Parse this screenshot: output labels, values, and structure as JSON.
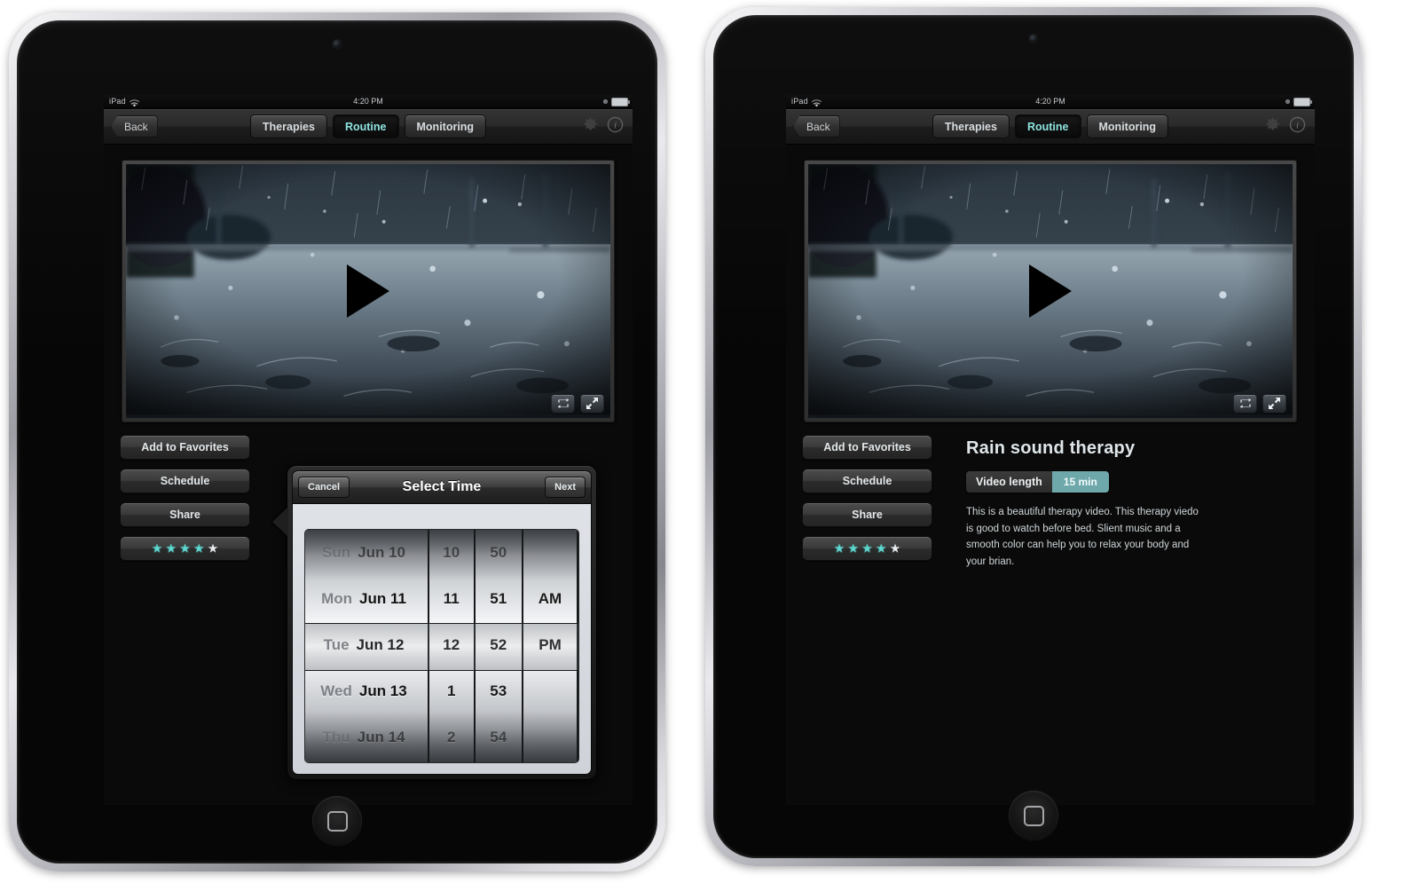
{
  "statusbar": {
    "device": "iPad",
    "time": "4:20 PM",
    "wifi_icon": "wifi-icon",
    "battery_icon": "battery-icon"
  },
  "navbar": {
    "back_label": "Back",
    "tabs": [
      {
        "label": "Therapies",
        "active": false
      },
      {
        "label": "Routine",
        "active": true
      },
      {
        "label": "Monitoring",
        "active": false
      }
    ],
    "settings_icon": "gear-icon",
    "info_icon": "info-icon",
    "accent_color": "#8ee3e0"
  },
  "video": {
    "play_icon": "play-icon",
    "loop_icon": "repeat-icon",
    "fullscreen_icon": "expand-icon"
  },
  "actions": {
    "favorites_label": "Add to Favorites",
    "schedule_label": "Schedule",
    "share_label": "Share",
    "rating_filled": 4,
    "rating_total": 5,
    "star_glyph": "★",
    "star_color": "#5ed7d0"
  },
  "details": {
    "title": "Rain sound therapy",
    "length_label": "Video length",
    "length_value": "15 min",
    "length_value_bg": "#6fa8ab",
    "description": "This is a beautiful therapy video. This therapy viedo is good to watch before bed. Slient music and a smooth color can help you to relax your body and your brian."
  },
  "picker": {
    "cancel_label": "Cancel",
    "title": "Select Time",
    "next_label": "Next",
    "days": [
      {
        "dow": "Sun",
        "date": "Jun 10"
      },
      {
        "dow": "Mon",
        "date": "Jun 11"
      },
      {
        "dow": "Tue",
        "date": "Jun 12"
      },
      {
        "dow": "Wed",
        "date": "Jun 13"
      },
      {
        "dow": "Thu",
        "date": "Jun 14"
      }
    ],
    "hours": [
      "10",
      "11",
      "12",
      "1",
      "2"
    ],
    "minutes": [
      "50",
      "51",
      "52",
      "53",
      "54"
    ],
    "meridiem": [
      "",
      "AM",
      "PM",
      "",
      ""
    ],
    "selected": {
      "day": "Tue Jun 12",
      "hour": "12",
      "minute": "52",
      "meridiem": "PM"
    }
  }
}
